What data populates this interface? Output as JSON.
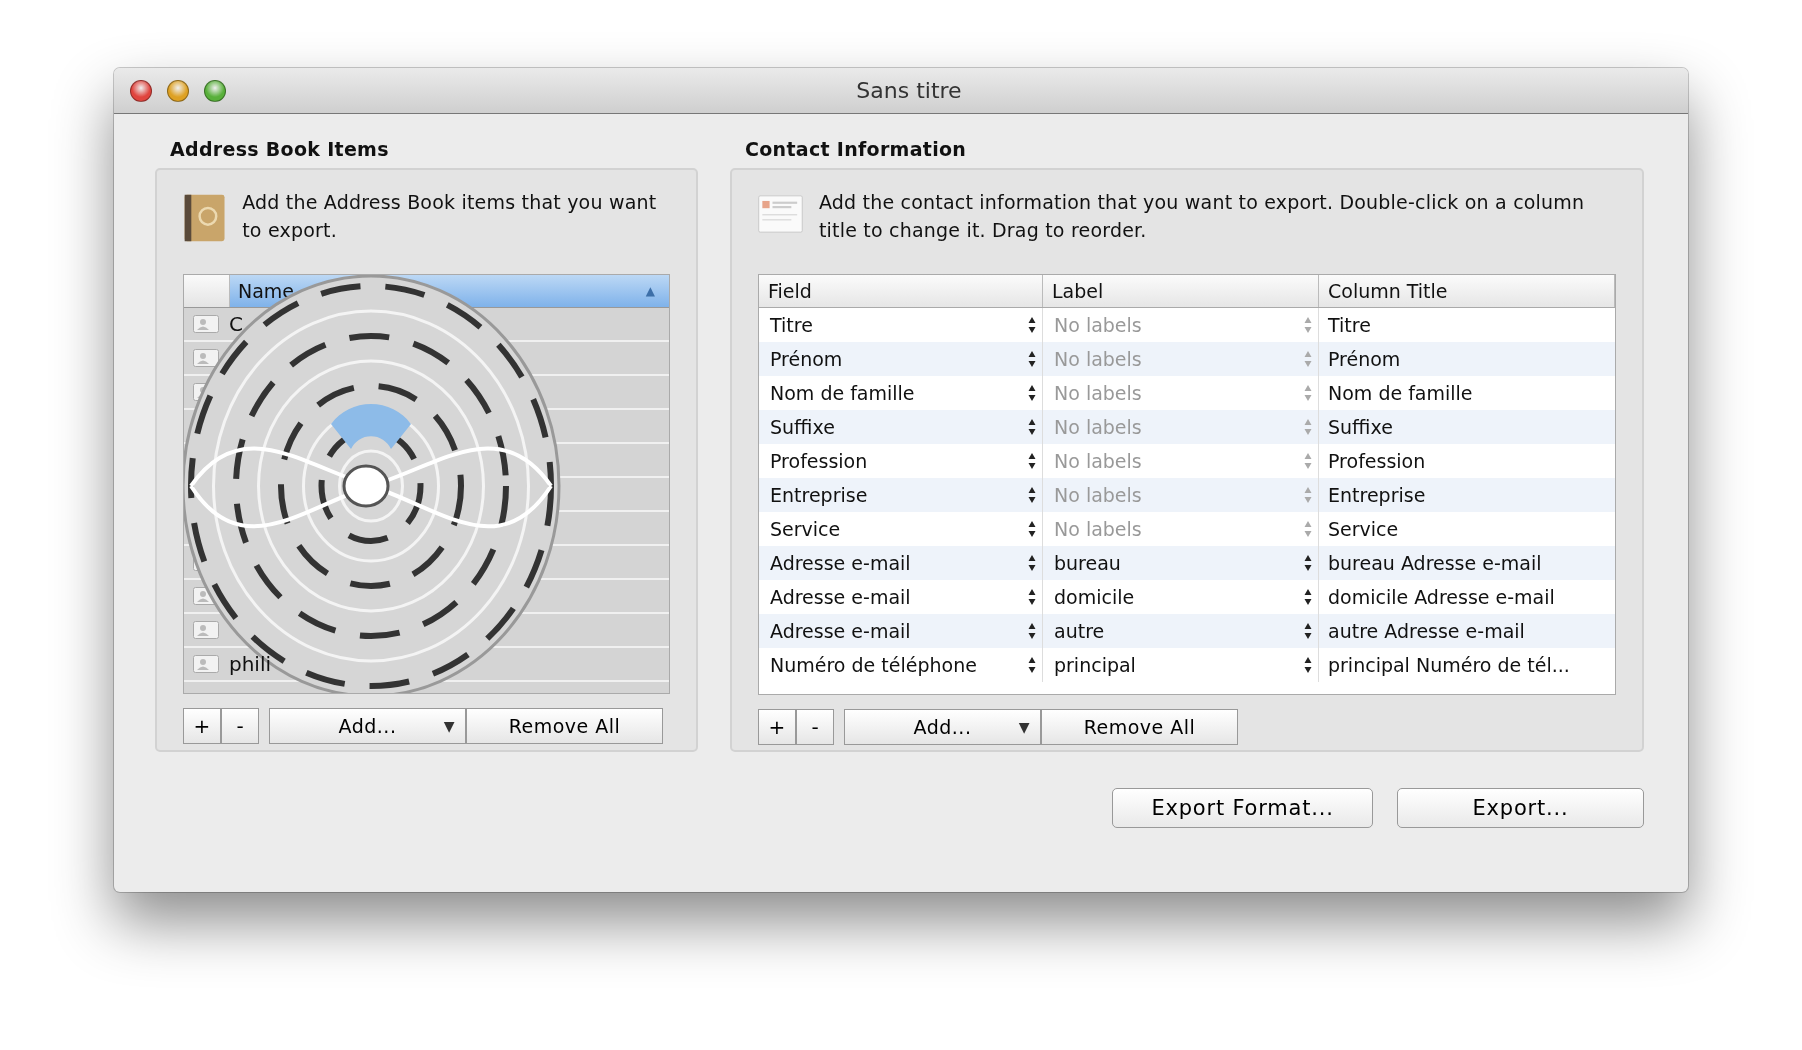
{
  "window": {
    "title": "Sans titre"
  },
  "address_book": {
    "title": "Address Book Items",
    "description": "Add the Address Book items that you want to export.",
    "column": "Name",
    "sort_arrow": "▲",
    "rows": [
      {
        "kind": "named",
        "name": "C"
      },
      {
        "kind": "covered"
      },
      {
        "kind": "covered"
      },
      {
        "kind": "hidden"
      },
      {
        "kind": "hidden"
      },
      {
        "kind": "hidden"
      },
      {
        "kind": "hidden"
      },
      {
        "kind": "covered"
      },
      {
        "kind": "covered"
      },
      {
        "kind": "covered"
      },
      {
        "kind": "named",
        "name": "phili"
      }
    ],
    "buttons": {
      "plus": "+",
      "minus": "-",
      "add": "Add...",
      "add_arrow": "▼",
      "remove_all": "Remove All"
    }
  },
  "contact_info": {
    "title": "Contact Information",
    "description": "Add the contact information that you want to export. Double-click on a column title to change it. Drag to reorder.",
    "columns": [
      "Field",
      "Label",
      "Column Title"
    ],
    "rows": [
      {
        "field": "Titre",
        "label": "No labels",
        "disabled": true,
        "column_title": "Titre"
      },
      {
        "field": "Prénom",
        "label": "No labels",
        "disabled": true,
        "column_title": "Prénom"
      },
      {
        "field": "Nom de famille",
        "label": "No labels",
        "disabled": true,
        "column_title": "Nom de famille"
      },
      {
        "field": "Suffixe",
        "label": "No labels",
        "disabled": true,
        "column_title": "Suffixe"
      },
      {
        "field": "Profession",
        "label": "No labels",
        "disabled": true,
        "column_title": "Profession"
      },
      {
        "field": "Entreprise",
        "label": "No labels",
        "disabled": true,
        "column_title": "Entreprise"
      },
      {
        "field": "Service",
        "label": "No labels",
        "disabled": true,
        "column_title": "Service"
      },
      {
        "field": "Adresse e-mail",
        "label": "bureau",
        "disabled": false,
        "column_title": "bureau Adresse e-mail"
      },
      {
        "field": "Adresse e-mail",
        "label": "domicile",
        "disabled": false,
        "column_title": "domicile Adresse e-mail"
      },
      {
        "field": "Adresse e-mail",
        "label": "autre",
        "disabled": false,
        "column_title": "autre Adresse e-mail"
      },
      {
        "field": "Numéro de téléphone",
        "label": "principal",
        "disabled": false,
        "column_title": "principal Numéro de tél..."
      }
    ],
    "buttons": {
      "plus": "+",
      "minus": "-",
      "add": "Add...",
      "add_arrow": "▼",
      "remove_all": "Remove All"
    }
  },
  "footer_buttons": [
    "Export Format...",
    "Export..."
  ]
}
